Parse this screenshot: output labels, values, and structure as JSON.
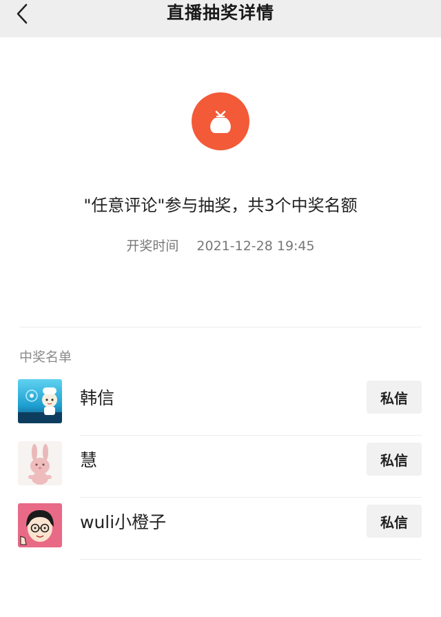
{
  "header": {
    "title": "直播抽奖详情",
    "back_icon": "chevron-left-icon"
  },
  "prize": {
    "icon": "gift-bag-icon",
    "icon_color": "#f35a38",
    "description": "\"任意评论\"参与抽奖，共3个中奖名额"
  },
  "draw": {
    "time_label": "开奖时间",
    "time_value": "2021-12-28 19:45"
  },
  "winners": {
    "section_title": "中奖名单",
    "items": [
      {
        "name": "韩信",
        "action_label": "私信"
      },
      {
        "name": "慧",
        "action_label": "私信"
      },
      {
        "name": "wuli小橙子",
        "action_label": "私信"
      }
    ]
  }
}
